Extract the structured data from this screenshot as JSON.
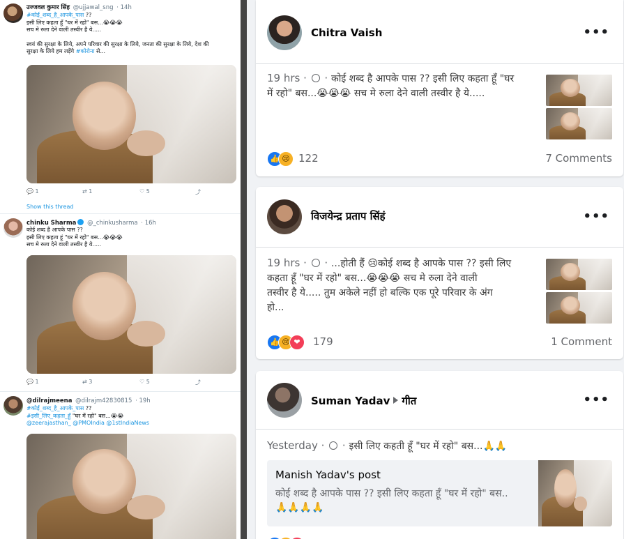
{
  "twitter": {
    "tweets": [
      {
        "name": "उज्जवल कुमार सिंह",
        "handle": "@ujjawal_sng",
        "time": "· 14h",
        "lines": [
          {
            "blue": "#कोई_शब्द_है_आपके_पास",
            "text": " ??"
          },
          {
            "blue": "",
            "text": "इसी लिए कहता हूँ \"घर में रहो\" बस...😭😭😭"
          },
          {
            "blue": "",
            "text": "सच मे रुला देने वाली तस्वीर है ये....."
          },
          {
            "blue": "",
            "text": ""
          },
          {
            "blue": "",
            "text": "स्वयं की सुरक्षा के लिये, अपने परिवार की सुरक्षा के लिये, जनता की सुरक्षा के लिये, देश की"
          },
          {
            "blue": "",
            "text": "सुरक्षा के लिये हम लड़ेंगे "
          },
          {
            "blue": "#कोरोना",
            "text": " से..."
          }
        ],
        "replies": "1",
        "retweets": "1",
        "likes": "5",
        "show_thread": "Show this thread"
      },
      {
        "name": "chinku Sharma",
        "handle": "@_chinkusharma",
        "time": "· 16h",
        "lines": [
          {
            "blue": "",
            "text": "कोई शब्द है आपके पास ??"
          },
          {
            "blue": "",
            "text": "इसी लिए कहता हूं \"घर में रहो\" बस...😭😭😭"
          },
          {
            "blue": "",
            "text": "सच मे रुला देने वाली तस्वीर है ये....."
          }
        ],
        "replies": "1",
        "retweets": "3",
        "likes": "5"
      },
      {
        "name": "@dilrajmeena",
        "handle": "@dilrajm42830815",
        "time": "· 19h",
        "lines": [
          {
            "blue": "#कोई_शब्द_है_आपके_पास",
            "text": " ??"
          },
          {
            "blue": "#इसी_लिए_कहता_हूँ",
            "text": " \"घर में रहो\" बस...😭😭"
          },
          {
            "blue": "@zeerajasthan_ @PMOIndia @1stIndiaNews",
            "text": ""
          }
        ]
      }
    ],
    "icons": {
      "reply": "💬",
      "retweet": "⇄",
      "like": "♡",
      "share": "⤴"
    }
  },
  "facebook": {
    "posts": [
      {
        "name": "Chitra Vaish",
        "time": "19 hrs",
        "lines": [
          "कोई शब्द है आपके पास ?? इसी लिए कहता हूँ \"घर",
          "में रहो\" बस...😭😭😭 सच मे रुला देने वाली तस्वीर है ये....."
        ],
        "reactions": "122",
        "comments": "7 Comments"
      },
      {
        "name": "विजयेन्द्र प्रताप सिंहं",
        "time": "19 hrs",
        "lines": [
          "...होती हैं 😢कोई शब्द है आपके पास ?? इसी लिए",
          "कहता हूँ \"घर में रहो\" बस...😭😭😭 सच मे रुला देने वाली",
          "तस्वीर है ये..... तुम अकेले नहीं हो बल्कि एक पूरे परिवार के अंग",
          "हो..."
        ],
        "reactions": "179",
        "comments": "1 Comment"
      },
      {
        "name": "Suman Yadav",
        "group": "गीत",
        "time": "Yesterday",
        "text": "इसी लिए कहती हूँ \"घर में रहो\" बस...🙏🙏",
        "shared_title": "Manish Yadav's post",
        "shared_lines": [
          "कोई शब्द है आपके पास ?? इसी लिए कहता हूँ \"घर में रहो\" बस..",
          "🙏🙏🙏🙏"
        ]
      }
    ],
    "more_label": "•••",
    "reaction_icons": {
      "like": "👍",
      "sad": "😢",
      "love": "❤"
    }
  }
}
